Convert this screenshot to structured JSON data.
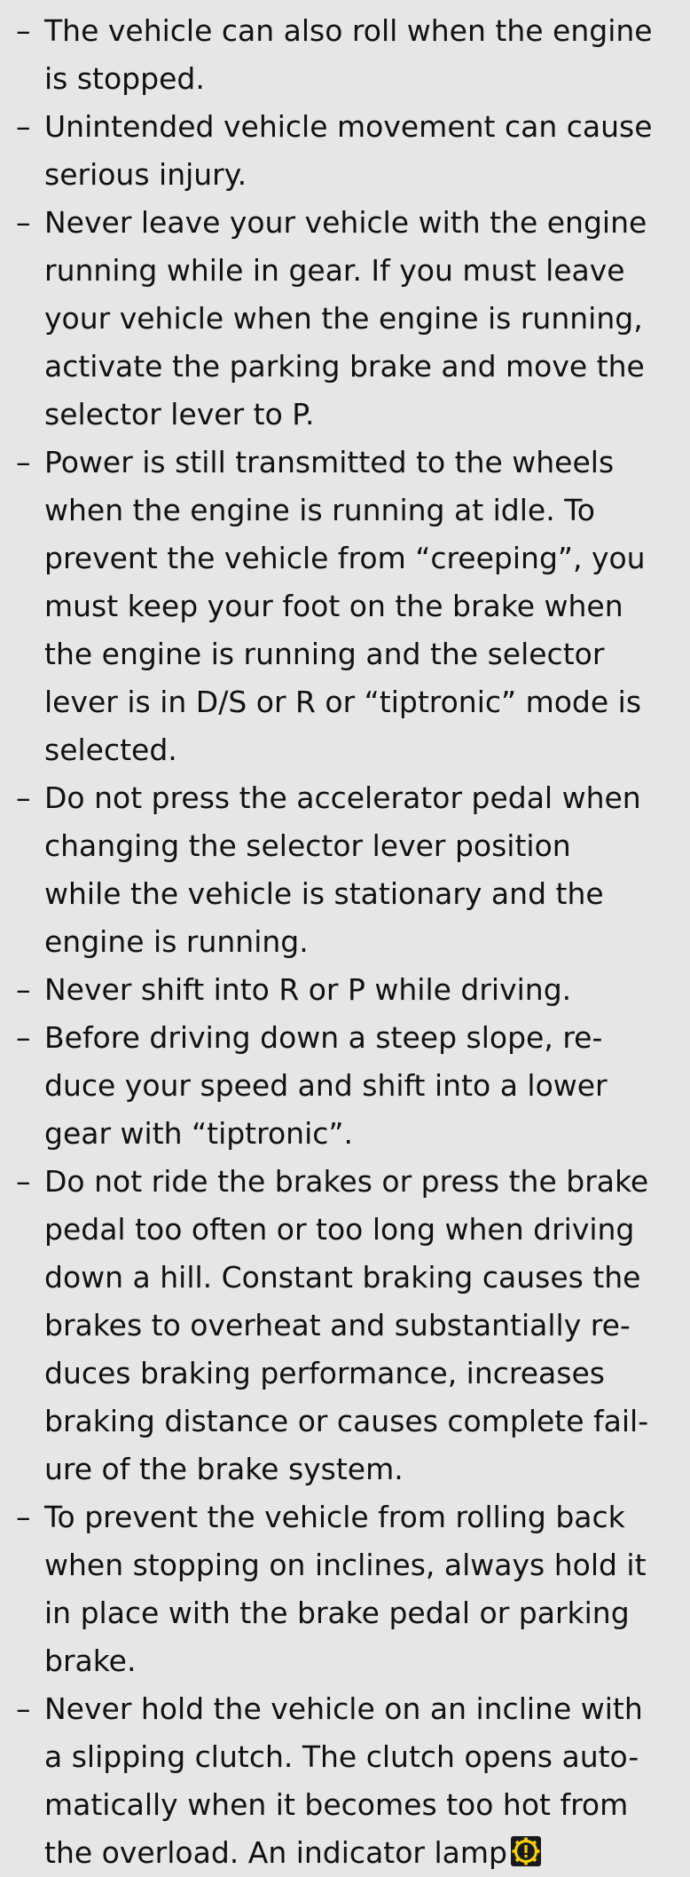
{
  "dash": "–",
  "items": [
    {
      "lines": [
        "The vehicle can also roll when the engine",
        "is stopped."
      ]
    },
    {
      "lines": [
        "Unintended vehicle movement can cause",
        "serious injury."
      ]
    },
    {
      "lines": [
        "Never leave your vehicle with the engine",
        "running while in gear. If you must leave",
        "your vehicle when the engine is running,",
        "activate the parking brake and move the",
        "selector lever to P."
      ]
    },
    {
      "lines": [
        "Power is still transmitted to the wheels",
        "when the engine is running at idle. To",
        "prevent the vehicle from “creeping”, you",
        "must keep your foot on the brake when",
        "the engine is running and the selector",
        "lever is in D/S or R or “tiptronic” mode is",
        "selected."
      ]
    },
    {
      "lines": [
        "Do not press the accelerator pedal when",
        "changing the selector lever position",
        "while the vehicle is stationary and the",
        "engine is running."
      ]
    },
    {
      "lines": [
        "Never shift into R or P while driving."
      ]
    },
    {
      "lines": [
        "Before driving down a steep slope, re-",
        "duce your speed and shift into a lower",
        "gear with “tiptronic”."
      ]
    },
    {
      "lines": [
        "Do not ride the brakes or press the brake",
        "pedal too often or too long when driving",
        "down a hill. Constant braking causes the",
        "brakes to overheat and substantially re-",
        "duces braking performance, increases",
        "braking distance or causes complete fail-",
        "ure of the brake system."
      ]
    },
    {
      "lines": [
        "To prevent the vehicle from rolling back",
        "when stopping on inclines, always hold it",
        "in place with the brake pedal or parking",
        "brake."
      ]
    },
    {
      "lines": [
        "Never hold the vehicle on an incline with",
        "a slipping clutch. The clutch opens auto-",
        "matically when it becomes too hot from",
        "the overload. An indicator lamp"
      ]
    }
  ],
  "icons": {
    "indicator_lamp": "transmission-warning-icon",
    "indicator_lamp_color": "#f5d000"
  }
}
